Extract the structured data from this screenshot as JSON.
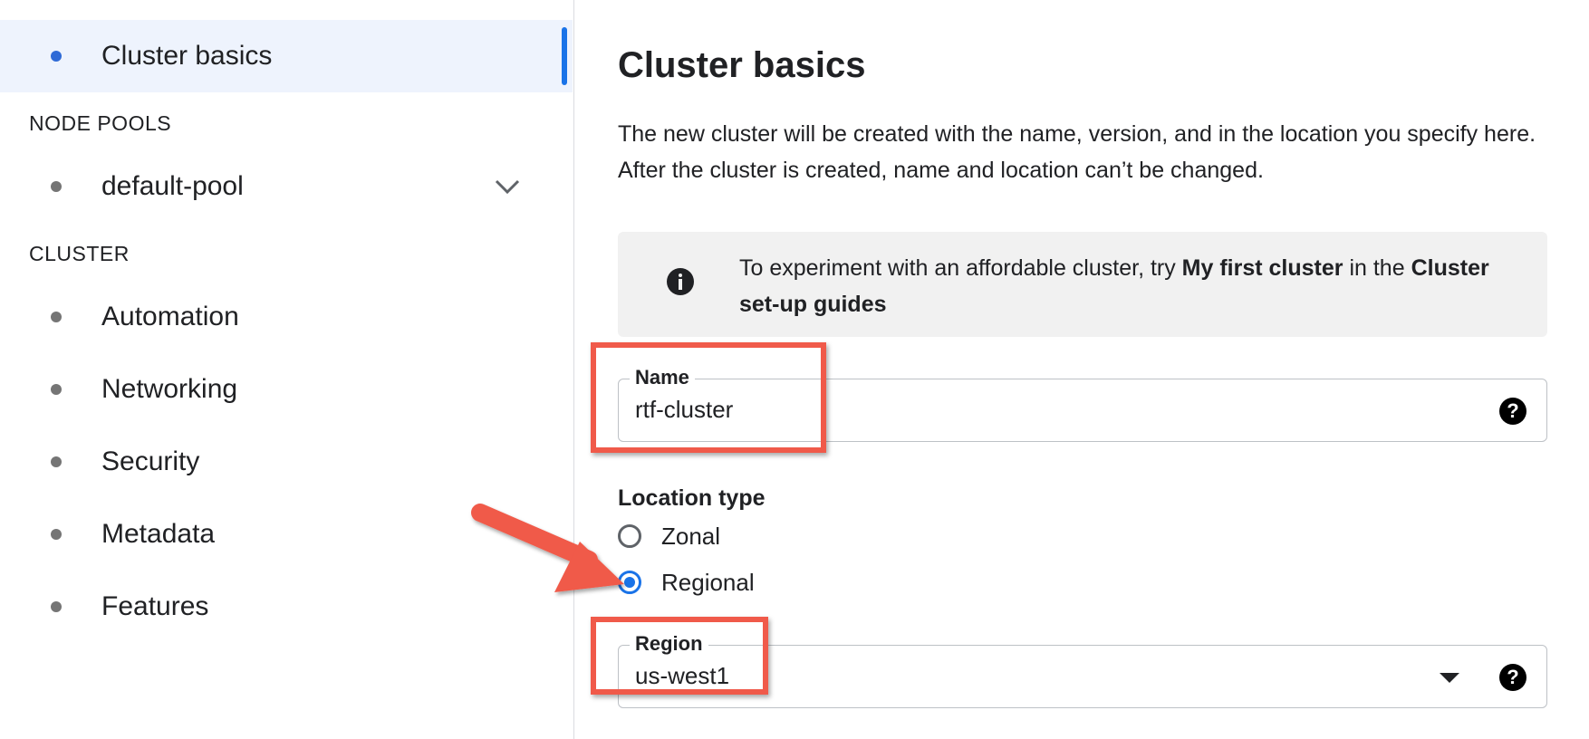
{
  "sidebar": {
    "active_item": {
      "label": "Cluster basics"
    },
    "node_pools_heading": "NODE POOLS",
    "node_pools": [
      {
        "label": "default-pool"
      }
    ],
    "cluster_heading": "CLUSTER",
    "cluster_items": [
      {
        "label": "Automation"
      },
      {
        "label": "Networking"
      },
      {
        "label": "Security"
      },
      {
        "label": "Metadata"
      },
      {
        "label": "Features"
      }
    ]
  },
  "main": {
    "title": "Cluster basics",
    "description": "The new cluster will be created with the name, version, and in the location you specify here. After the cluster is created, name and location can’t be changed.",
    "info": {
      "prefix": "To experiment with an affordable cluster, try ",
      "link1": "My first cluster",
      "middle": " in the ",
      "link2": "Cluster set-up guides"
    },
    "name_field": {
      "label": "Name",
      "value": "rtf-cluster"
    },
    "location_type": {
      "label": "Location type",
      "options": [
        {
          "label": "Zonal",
          "checked": false
        },
        {
          "label": "Regional",
          "checked": true
        }
      ]
    },
    "region_field": {
      "label": "Region",
      "value": "us-west1"
    },
    "help_glyph": "?"
  },
  "colors": {
    "accent": "#1a73e8",
    "active_bg": "#eef3fd",
    "annotation_red": "#f05a4a",
    "info_bg": "#f1f1f1"
  },
  "icons": {
    "chevron": "chevron-down-icon",
    "info": "info-icon",
    "help": "help-icon",
    "dropdown": "dropdown-arrow-icon"
  }
}
